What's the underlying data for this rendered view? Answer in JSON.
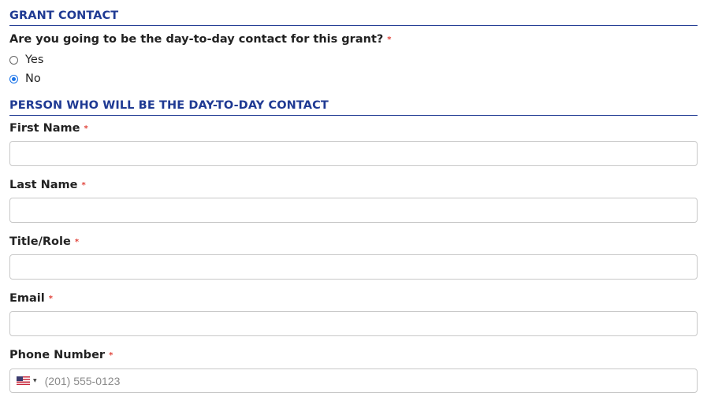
{
  "grant_contact": {
    "header": "GRANT CONTACT",
    "question": "Are you going to be the day-to-day contact for this grant?",
    "required_mark": "*",
    "options": [
      {
        "label": "Yes",
        "selected": false
      },
      {
        "label": "No",
        "selected": true
      }
    ]
  },
  "contact_person": {
    "header": "PERSON WHO WILL BE THE DAY-TO-DAY CONTACT",
    "fields": {
      "first_name": {
        "label": "First Name",
        "value": ""
      },
      "last_name": {
        "label": "Last Name",
        "value": ""
      },
      "title_role": {
        "label": "Title/Role",
        "value": ""
      },
      "email": {
        "label": "Email",
        "value": ""
      },
      "phone": {
        "label": "Phone Number",
        "placeholder": "(201) 555-0123",
        "country_flag": "us-flag-icon",
        "value": ""
      }
    }
  },
  "colors": {
    "header_blue": "#1f3a93",
    "required_red": "#e0433a",
    "radio_blue": "#1a73e8"
  }
}
